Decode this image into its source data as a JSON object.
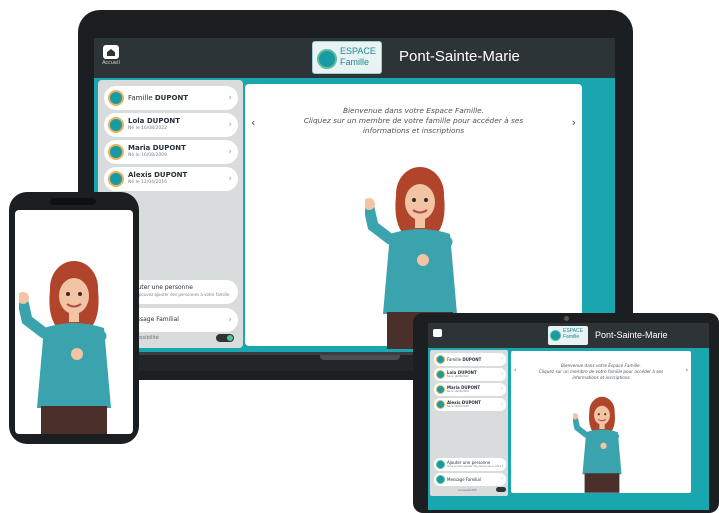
{
  "app": {
    "home_label": "Accueil",
    "logo_line1": "ESPACE",
    "logo_line2": "Famille",
    "title": "Pont-Sainte-Marie"
  },
  "sidebar": {
    "family": {
      "prefix": "Famille",
      "name": "DUPONT"
    },
    "members": [
      {
        "name": "Lola DUPONT",
        "sub": "Né le 16/08/2022"
      },
      {
        "name": "Maria DUPONT",
        "sub": "Né le 16/08/2009"
      },
      {
        "name": "Alexis DUPONT",
        "sub": "Né le 12/04/2016"
      }
    ],
    "add_person": {
      "title": "Ajouter une personne",
      "sub": "Vous pouvez ajouter des personnes à votre famille"
    },
    "messaging": {
      "title": "Message Familial"
    },
    "toggle_label": "Accessibilité"
  },
  "welcome": {
    "line1": "Bienvenue dans votre Espace Famille.",
    "line2": "Cliquez sur un membre de votre famille pour accéder à ses",
    "line3": "informations et inscriptions"
  },
  "colors": {
    "accent": "#1aa6ae",
    "topbar": "#2d3437",
    "frame": "#1c1f22"
  },
  "icons": {
    "home": "home-icon",
    "chevron": "chevron-right-icon",
    "prev": "chevron-left-icon",
    "next": "chevron-right-icon"
  },
  "glyphs": {
    "prev": "‹",
    "next": "›",
    "chev": "›"
  }
}
